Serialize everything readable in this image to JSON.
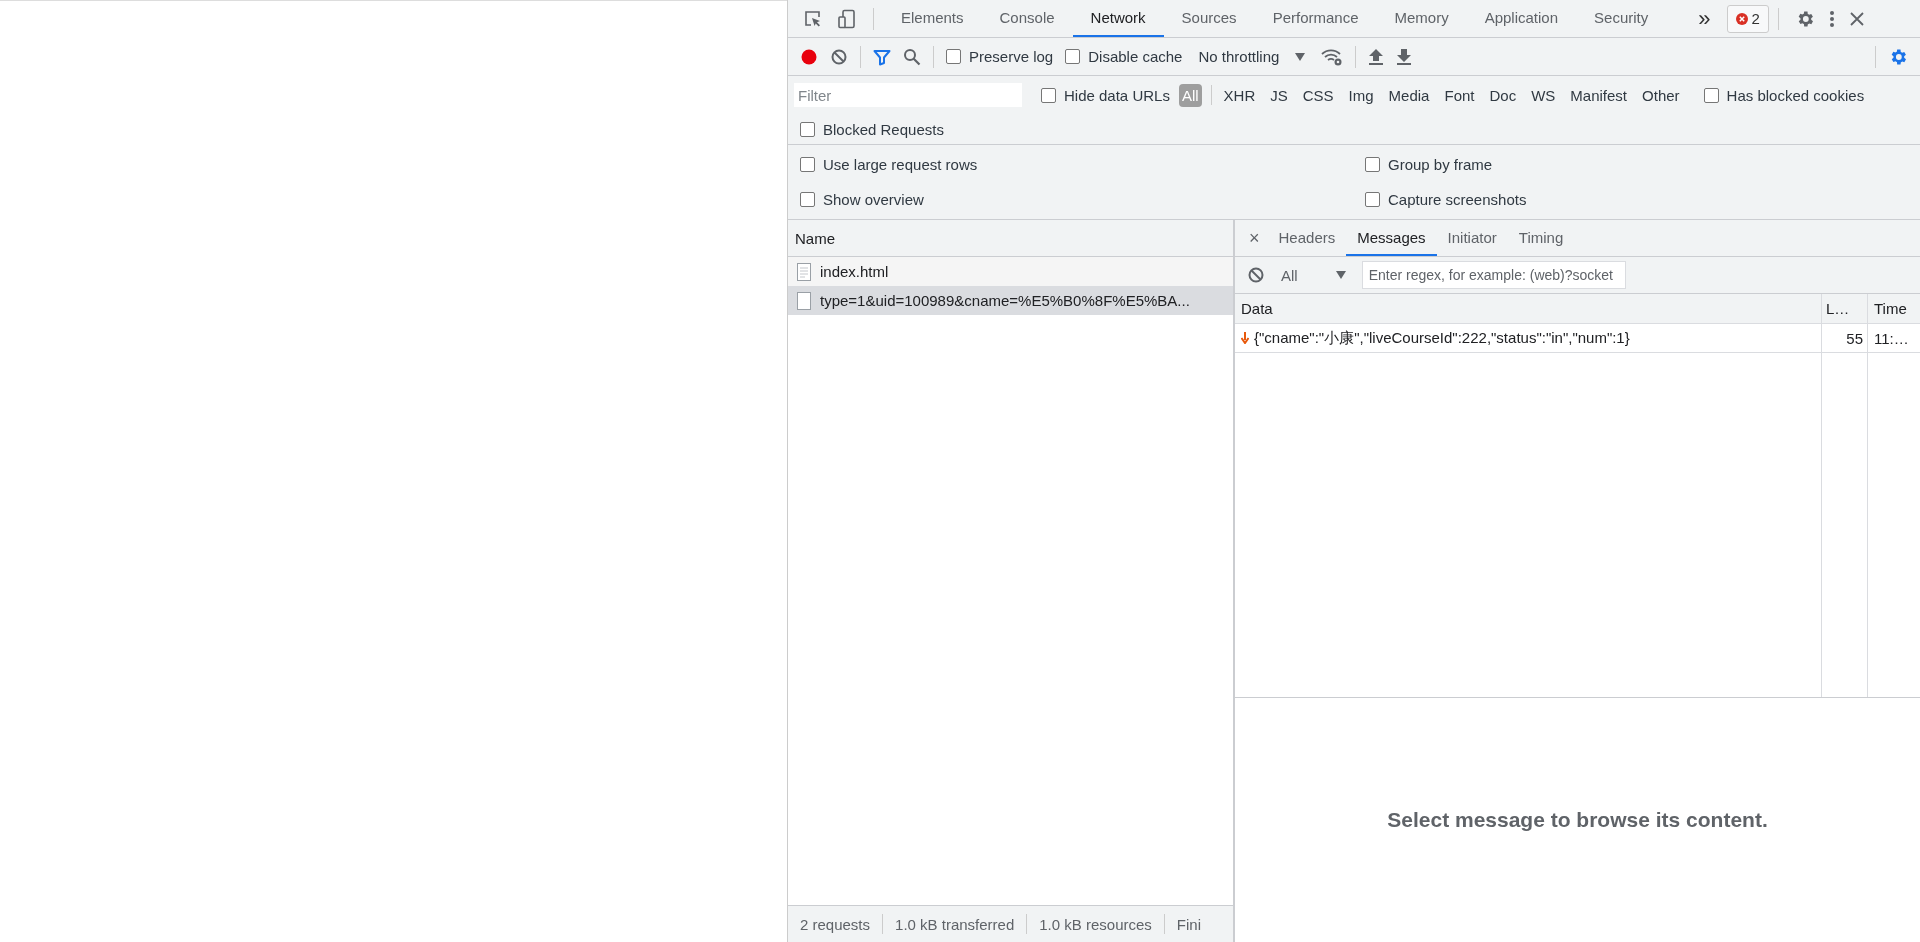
{
  "main_tabs": [
    {
      "label": "Elements",
      "selected": false
    },
    {
      "label": "Console",
      "selected": false
    },
    {
      "label": "Network",
      "selected": true
    },
    {
      "label": "Sources",
      "selected": false
    },
    {
      "label": "Performance",
      "selected": false
    },
    {
      "label": "Memory",
      "selected": false
    },
    {
      "label": "Application",
      "selected": false
    },
    {
      "label": "Security",
      "selected": false
    }
  ],
  "more_tabs": "»",
  "error_badge": {
    "count": "2"
  },
  "toolbar": {
    "recording": true,
    "checkboxes": [
      {
        "label": "Preserve log",
        "checked": false
      },
      {
        "label": "Disable cache",
        "checked": false
      }
    ],
    "throttling": "No throttling"
  },
  "filter": {
    "placeholder": "Filter",
    "hide_data_urls": {
      "label": "Hide data URLs",
      "checked": false
    },
    "types": [
      {
        "label": "All",
        "selected": true
      },
      {
        "label": "XHR",
        "selected": false
      },
      {
        "label": "JS",
        "selected": false
      },
      {
        "label": "CSS",
        "selected": false
      },
      {
        "label": "Img",
        "selected": false
      },
      {
        "label": "Media",
        "selected": false
      },
      {
        "label": "Font",
        "selected": false
      },
      {
        "label": "Doc",
        "selected": false
      },
      {
        "label": "WS",
        "selected": false
      },
      {
        "label": "Manifest",
        "selected": false
      },
      {
        "label": "Other",
        "selected": false
      }
    ],
    "has_blocked_cookies": {
      "label": "Has blocked cookies",
      "checked": false
    },
    "blocked_requests": {
      "label": "Blocked Requests",
      "checked": false
    }
  },
  "settings": [
    {
      "label": "Use large request rows",
      "checked": false
    },
    {
      "label": "Group by frame",
      "checked": false
    },
    {
      "label": "Show overview",
      "checked": false
    },
    {
      "label": "Capture screenshots",
      "checked": false
    }
  ],
  "requests": {
    "column": "Name",
    "rows": [
      {
        "name": "index.html",
        "kind": "document",
        "selected": false
      },
      {
        "name": "type=1&uid=100989&cname=%E5%B0%8F%E5%BA...",
        "kind": "websocket",
        "selected": true
      }
    ]
  },
  "detail": {
    "close": "×",
    "tabs": [
      {
        "label": "Headers",
        "selected": false
      },
      {
        "label": "Messages",
        "selected": true
      },
      {
        "label": "Initiator",
        "selected": false
      },
      {
        "label": "Timing",
        "selected": false
      }
    ],
    "message_filter": {
      "type": "All",
      "placeholder": "Enter regex, for example: (web)?socket"
    },
    "columns": [
      "Data",
      "L…",
      "Time"
    ],
    "messages": [
      {
        "kind": "received",
        "data": "{\"cname\":\"小康\",\"liveCourseId\":222,\"status\":\"in\",\"num\":1}",
        "length": "55",
        "time": "11:…"
      }
    ],
    "empty_text": "Select message to browse its content."
  },
  "status_bar": [
    "2 requests",
    "1.0 kB transferred",
    "1.0 kB resources",
    "Fini"
  ]
}
